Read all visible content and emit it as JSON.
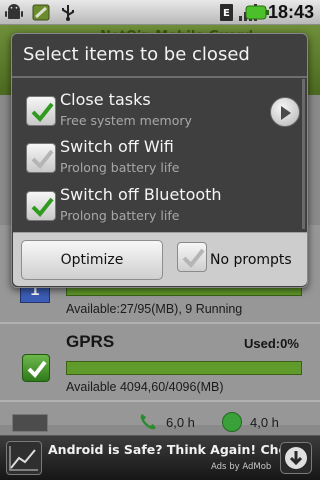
{
  "status_bar": {
    "time": "18:43",
    "icons": [
      "android-icon",
      "app-icon",
      "usb-icon",
      "edge-icon",
      "signal-icon",
      "battery-icon"
    ]
  },
  "background_app": {
    "header_title": "NetQin Mobile Guard",
    "memory_status": "Available:27/95(MB), 9 Running",
    "gprs": {
      "title": "GPRS",
      "used_label": "Used:0%",
      "available": "Available 4094,60/4096(MB)"
    },
    "times": [
      "6,0 h",
      "4,0 h"
    ]
  },
  "dialog": {
    "title": "Select items to be closed",
    "options": [
      {
        "title": "Close tasks",
        "subtitle": "Free system memory",
        "checked": true
      },
      {
        "title": "Switch off Wifi",
        "subtitle": "Prolong battery life",
        "checked": false
      },
      {
        "title": "Switch off Bluetooth",
        "subtitle": "Prolong battery life",
        "checked": true
      }
    ],
    "optimize_label": "Optimize",
    "no_prompts_label": "No prompts",
    "no_prompts_checked": false
  },
  "ad": {
    "text": "Android is Safe? Think Again! Check",
    "by": "Ads by AdMob"
  },
  "colors": {
    "check_green": "#2f9a1e",
    "check_gray": "#b5b5b5",
    "bar_green": "#5f9a2a",
    "dialog_bg": "#3f3f3f"
  }
}
